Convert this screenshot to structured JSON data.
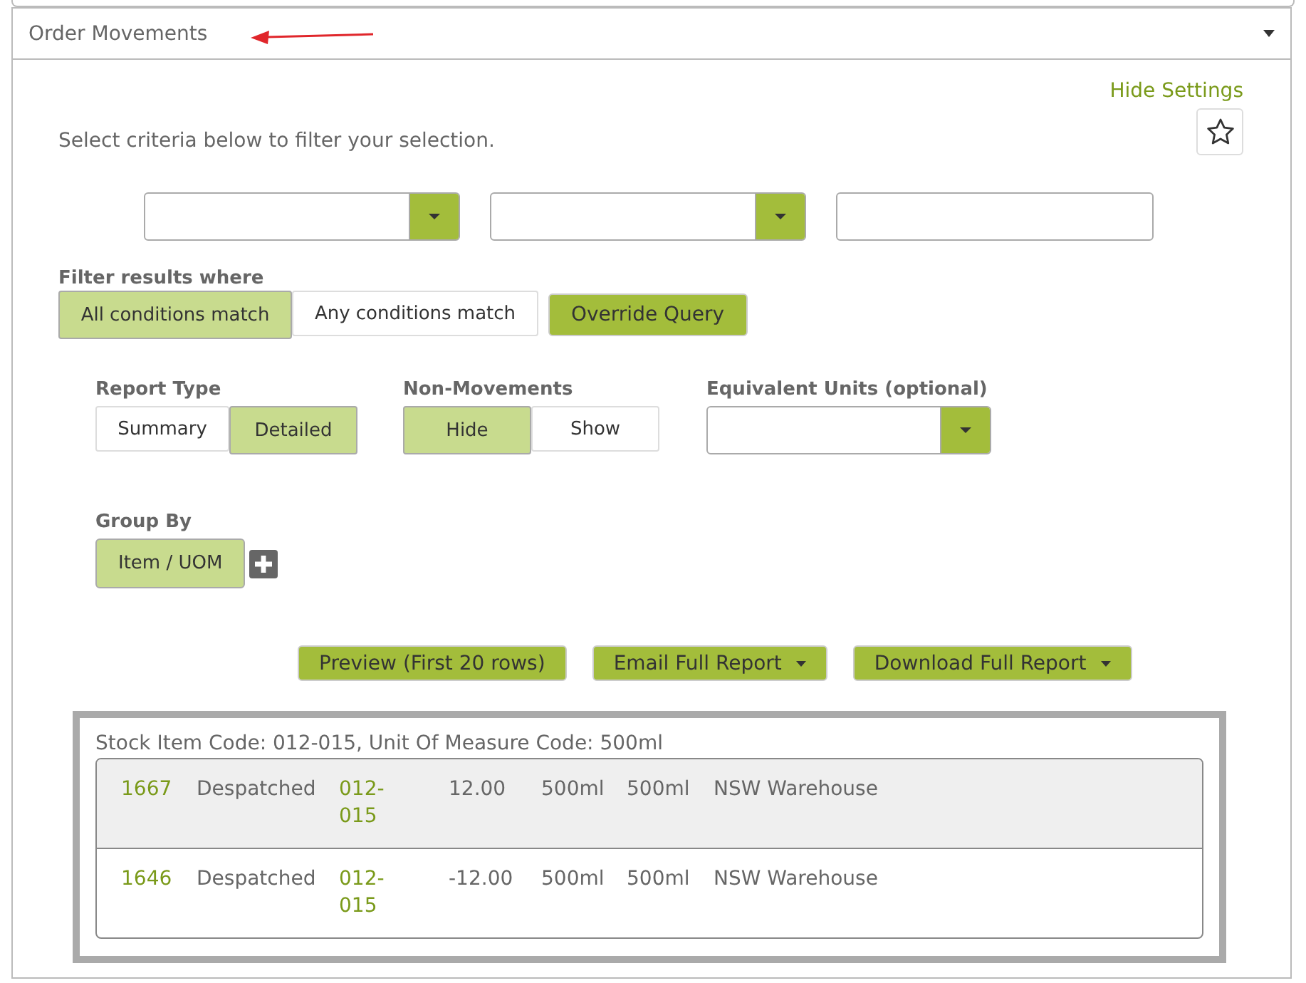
{
  "panel": {
    "title": "Order Movements",
    "expanded": true
  },
  "hide_settings": "Hide Settings",
  "instructions": "Select criteria below to filter your selection.",
  "criteria": [
    {
      "kind": "dropdown"
    },
    {
      "kind": "dropdown"
    },
    {
      "kind": "text"
    }
  ],
  "filter": {
    "label": "Filter results where",
    "options": [
      {
        "label": "All conditions match",
        "selected": true
      },
      {
        "label": "Any conditions match",
        "selected": false
      }
    ],
    "override_button": "Override Query"
  },
  "report_type": {
    "label": "Report Type",
    "options": [
      {
        "label": "Summary",
        "selected": false
      },
      {
        "label": "Detailed",
        "selected": true
      }
    ]
  },
  "non_movements": {
    "label": "Non-Movements",
    "options": [
      {
        "label": "Hide",
        "selected": true
      },
      {
        "label": "Show",
        "selected": false
      }
    ]
  },
  "equivalent_units": {
    "label": "Equivalent Units (optional)"
  },
  "group_by": {
    "label": "Group By",
    "items": [
      "Item / UOM"
    ]
  },
  "actions": [
    {
      "label": "Preview (First 20 rows)",
      "dropdown": false
    },
    {
      "label": "Email Full Report",
      "dropdown": true
    },
    {
      "label": "Download Full Report",
      "dropdown": true
    }
  ],
  "results": {
    "caption": "Stock Item Code: 012-015, Unit Of Measure Code: 500ml",
    "rows": [
      {
        "selected": true,
        "id": "1667",
        "status": "Despatched",
        "code": "012-015",
        "quantity": "12.00",
        "unit_1": "500ml",
        "unit_2": "500ml",
        "location": "NSW Warehouse"
      },
      {
        "selected": false,
        "id": "1646",
        "status": "Despatched",
        "code": "012-015",
        "quantity": "-12.00",
        "unit_1": "500ml",
        "unit_2": "500ml",
        "location": "NSW Warehouse"
      }
    ]
  }
}
